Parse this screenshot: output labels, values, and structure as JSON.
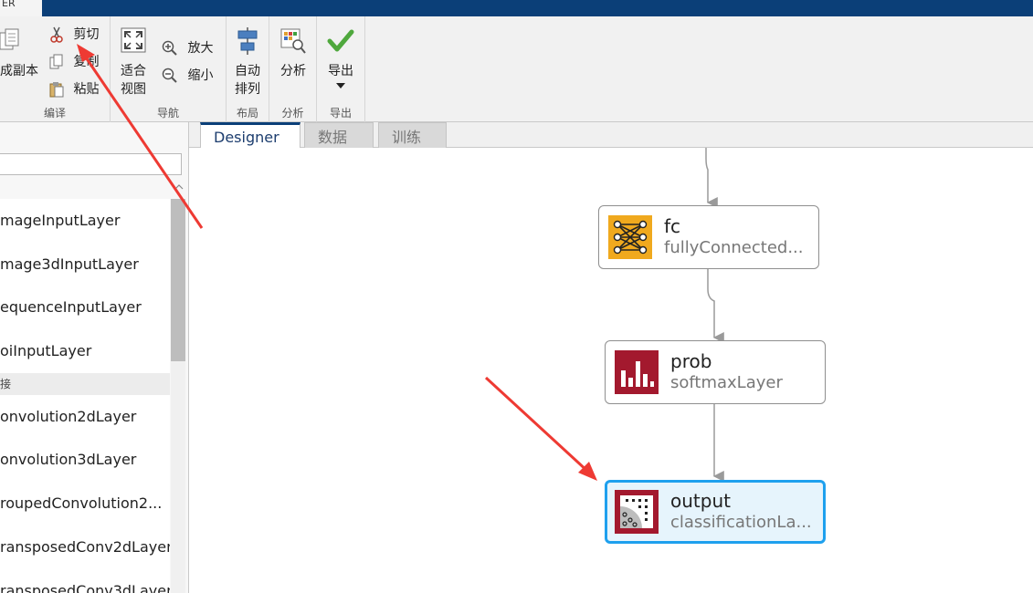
{
  "titlebar": {
    "tab_stub": "ER"
  },
  "toolstrip": {
    "edit": {
      "duplicate_label": "成副本",
      "cut_label": "剪切",
      "copy_label": "复制",
      "paste_label": "粘贴",
      "section_label": "编译"
    },
    "navigate": {
      "fit_label_1": "适合",
      "fit_label_2": "视图",
      "zoom_in_label": "放大",
      "zoom_out_label": "缩小",
      "section_label": "导航"
    },
    "layout": {
      "auto_label_1": "自动",
      "auto_label_2": "排列",
      "section_label": "布局"
    },
    "analyze": {
      "analyze_label": "分析",
      "section_label": "分析"
    },
    "export": {
      "export_label": "导出",
      "section_label": "导出"
    }
  },
  "library": {
    "search_placeholder": "",
    "items_input": [
      "mageInputLayer",
      "mage3dInputLayer",
      "equenceInputLayer",
      "oiInputLayer"
    ],
    "header_conv": "接",
    "items_conv": [
      "onvolution2dLayer",
      "onvolution3dLayer",
      "roupedConvolution2...",
      "ransposedConv2dLayer",
      "ransposedConv3dLayer"
    ]
  },
  "tabs": [
    {
      "label": "Designer",
      "active": true
    },
    {
      "label": "数据",
      "active": false
    },
    {
      "label": "训练",
      "active": false
    }
  ],
  "nodes": [
    {
      "name": "fc",
      "type": "fullyConnected...",
      "icon": "fully-connected-icon",
      "color": "#f0a91e",
      "selected": false
    },
    {
      "name": "prob",
      "type": "softmaxLayer",
      "icon": "softmax-icon",
      "color": "#a3192e",
      "selected": false
    },
    {
      "name": "output",
      "type": "classificationLa...",
      "icon": "classification-icon",
      "color": "#a3192e",
      "selected": true
    }
  ],
  "colors": {
    "accent": "#0b3f78",
    "selection": "#1ea0ee",
    "annotation_arrow": "#ee3a33"
  }
}
